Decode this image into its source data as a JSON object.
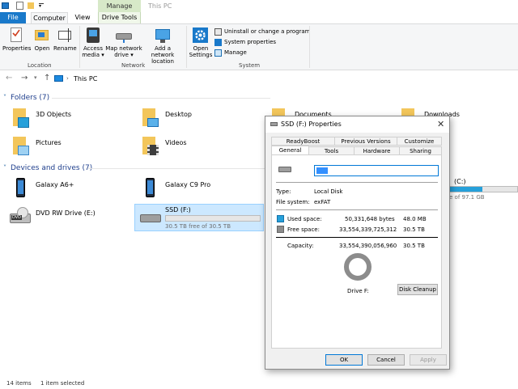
{
  "window": {
    "title": "This PC"
  },
  "ribbon": {
    "tabs": {
      "file": "File",
      "computer": "Computer",
      "view": "View",
      "manage": "Manage",
      "drive_tools": "Drive Tools"
    },
    "buttons": {
      "properties": "Properties",
      "open": "Open",
      "rename": "Rename",
      "access_media": "Access media ▾",
      "map_network_drive": "Map network drive ▾",
      "add_network_location": "Add a network location",
      "open_settings": "Open Settings",
      "uninstall": "Uninstall or change a program",
      "system_properties": "System properties",
      "manage": "Manage"
    },
    "groups": {
      "location": "Location",
      "network": "Network",
      "system": "System"
    }
  },
  "address": {
    "path": "This PC"
  },
  "folders_header": "Folders (7)",
  "folders": [
    "3D Objects",
    "Desktop",
    "Documents",
    "Downloads",
    "Pictures",
    "Videos"
  ],
  "devices_header": "Devices and drives (7)",
  "devices": {
    "galaxy_a6": "Galaxy A6+",
    "galaxy_c9": "Galaxy C9 Pro",
    "dvd": "DVD RW Drive (E:)",
    "ssd_name": "SSD (F:)",
    "ssd_free": "30.5 TB free of 30.5 TB",
    "c_name": "(C:)",
    "c_free": "e of 97.1 GB"
  },
  "status": {
    "items": "14 items",
    "selected": "1 item selected"
  },
  "dialog": {
    "title": "SSD (F:) Properties",
    "tabs_top": [
      "ReadyBoost",
      "Previous Versions",
      "Customize"
    ],
    "tabs_bottom": [
      "General",
      "Tools",
      "Hardware",
      "Sharing"
    ],
    "name_value": "SSD",
    "type_label": "Type:",
    "type_value": "Local Disk",
    "fs_label": "File system:",
    "fs_value": "exFAT",
    "used_label": "Used space:",
    "used_bytes": "50,331,648 bytes",
    "used_size": "48.0 MB",
    "free_label": "Free space:",
    "free_bytes": "33,554,339,725,312",
    "free_size": "30.5 TB",
    "cap_label": "Capacity:",
    "cap_bytes": "33,554,390,056,960",
    "cap_size": "30.5 TB",
    "drive_label": "Drive F:",
    "disk_cleanup": "Disk Cleanup",
    "ok": "OK",
    "cancel": "Cancel",
    "apply": "Apply",
    "colors": {
      "used": "#26a0da",
      "free": "#8c8c8c"
    }
  }
}
